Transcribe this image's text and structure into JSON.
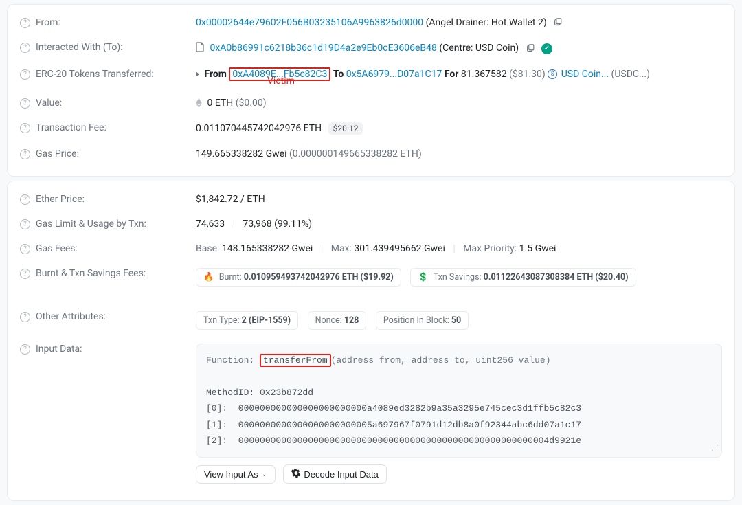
{
  "section1": {
    "from": {
      "label": "From:",
      "address": "0x00002644e79602F056B03235106A9963826d0000",
      "tag": " (Angel Drainer: Hot Wallet 2) "
    },
    "to": {
      "label": "Interacted With (To):",
      "address": "0xA0b86991c6218b36c1d19D4a2e9Eb0cE3606eB48",
      "tag": " (Centre: USD Coin) "
    },
    "erc20": {
      "label": "ERC-20 Tokens Transferred:",
      "from_word": "From ",
      "from_addr": "0xA4089E...Fb5c82C3",
      "to_word": " To ",
      "to_addr": "0x5A6979...D07a1C17",
      "for_word": " For ",
      "amount": "81.367582",
      "usd": " ($81.30) ",
      "token": "USD Coin... ",
      "token_sym": "(USDC...)",
      "victim": "Victim"
    },
    "value": {
      "label": "Value:",
      "text": "0 ETH",
      "usd": " ($0.00)"
    },
    "fee": {
      "label": "Transaction Fee:",
      "text": "0.011070445742042976 ETH",
      "badge": "$20.12"
    },
    "gas_price": {
      "label": "Gas Price:",
      "text": "149.665338282 Gwei ",
      "sub": "(0.000000149665338282 ETH)"
    }
  },
  "section2": {
    "ether_price": {
      "label": "Ether Price:",
      "text": "$1,842.72 / ETH"
    },
    "gas_limit": {
      "label": "Gas Limit & Usage by Txn:",
      "limit": "74,633",
      "used": "73,968 (99.11%)"
    },
    "gas_fees": {
      "label": "Gas Fees:",
      "base_l": "Base: ",
      "base": "148.165338282 Gwei",
      "max_l": "Max: ",
      "max": "301.439495662 Gwei",
      "prio_l": "Max Priority: ",
      "prio": "1.5 Gwei"
    },
    "burnt": {
      "label": "Burnt & Txn Savings Fees:",
      "burnt_l": "Burnt: ",
      "burnt_v": "0.010959493742042976 ETH ($19.92)",
      "save_l": "Txn Savings: ",
      "save_v": "0.01122643087308384 ETH ($20.40)"
    },
    "attrs": {
      "label": "Other Attributes:",
      "p1a": "Txn Type: ",
      "p1b": "2 (EIP-1559)",
      "p2a": "Nonce: ",
      "p2b": "128",
      "p3a": "Position In Block: ",
      "p3b": "50"
    },
    "input": {
      "label": "Input Data:",
      "fn_l": "Function: ",
      "fn_name": "transferFrom",
      "fn_sig": "(address from, address to, uint256 value)",
      "method_l": "MethodID: ",
      "method": "0x23b872dd",
      "r0": "[0]:  000000000000000000000000a4089ed3282b9a35a3295e745cec3d1ffb5c82c3",
      "r1": "[1]:  0000000000000000000000005a697967f0791d12db8a0f92344abc6dd07a1c17",
      "r2": "[2]:  0000000000000000000000000000000000000000000000000000000004d9921e",
      "btn_view": "View Input As",
      "btn_decode": "Decode Input Data"
    }
  }
}
